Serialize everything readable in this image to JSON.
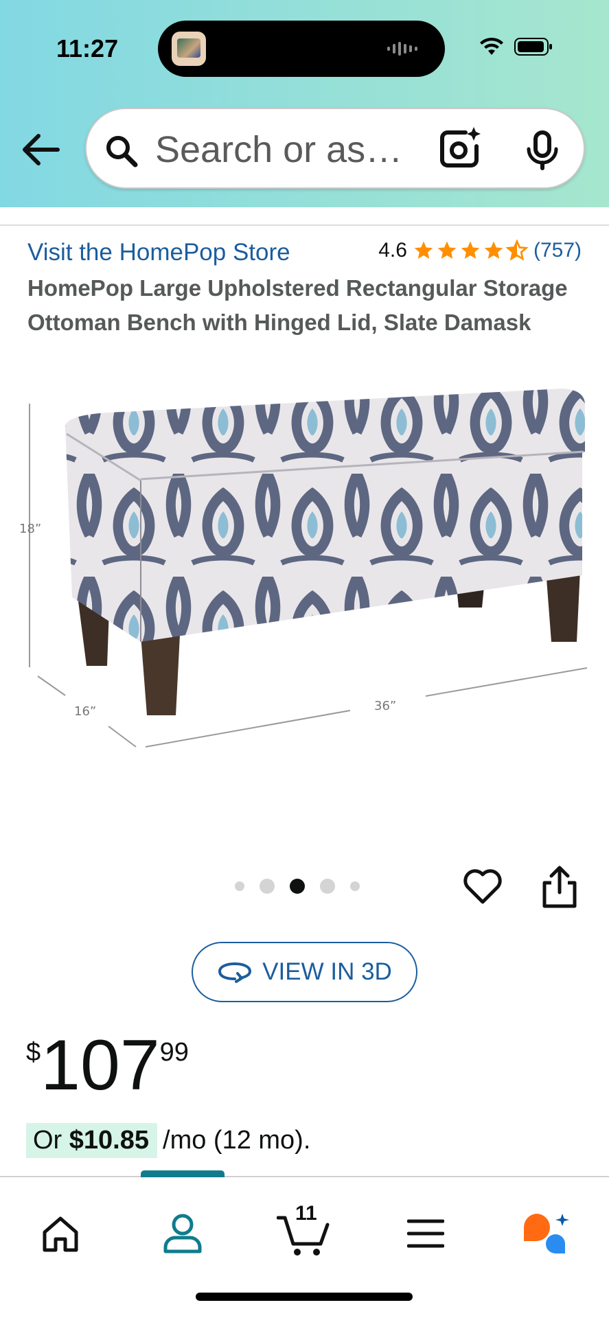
{
  "status_bar": {
    "time": "11:27"
  },
  "search": {
    "placeholder": "Search or as…"
  },
  "product": {
    "store_link": "Visit the HomePop Store",
    "rating": "4.6",
    "rating_stars": 4.6,
    "review_count": "(757)",
    "title": "HomePop Large Upholstered Rectangular Storage Ottoman Bench with Hinged Lid, Slate Damask",
    "image_dimensions": {
      "height": "18”",
      "depth": "16”",
      "width": "36”"
    },
    "carousel": {
      "total": 5,
      "active_index": 2
    },
    "view_3d_label": "VIEW IN 3D",
    "price": {
      "symbol": "$",
      "whole": "107",
      "fraction": "99"
    },
    "monthly": {
      "prefix": "Or ",
      "amount": "$10.85",
      "suffix": "/mo (12 mo)."
    }
  },
  "bottom_nav": {
    "items": [
      {
        "name": "home-icon"
      },
      {
        "name": "account-icon",
        "active": true
      },
      {
        "name": "cart-icon",
        "count": "11"
      },
      {
        "name": "menu-icon"
      },
      {
        "name": "rufus-icon"
      }
    ]
  },
  "colors": {
    "header_gradient_start": "#82d8e3",
    "header_gradient_end": "#a6e6ce",
    "link_blue": "#1b5d9e",
    "star_orange": "#ff8f00",
    "active_teal": "#0f7c8c",
    "monthly_highlight": "#d6f4e8"
  }
}
